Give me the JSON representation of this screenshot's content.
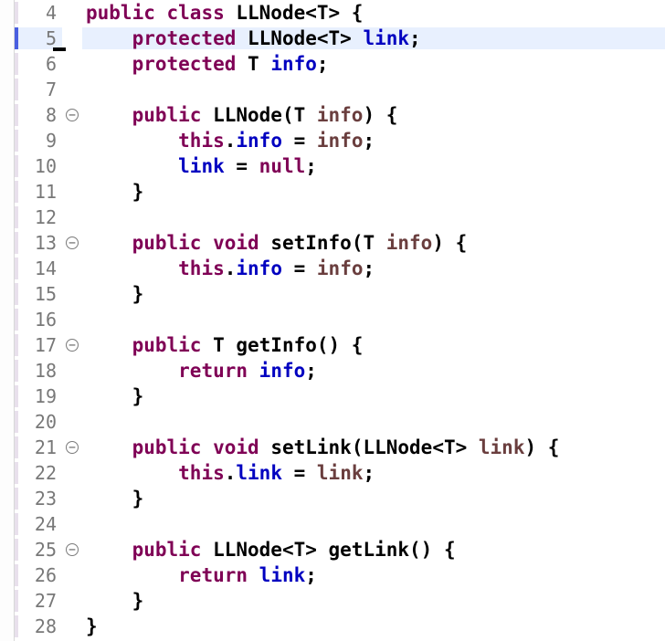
{
  "lines": [
    {
      "num": "4",
      "fold": "",
      "hl": false,
      "tokens": [
        [
          "kw",
          "public"
        ],
        [
          "plain",
          " "
        ],
        [
          "kw",
          "class"
        ],
        [
          "plain",
          " LLNode<T> {"
        ]
      ]
    },
    {
      "num": "5",
      "fold": "",
      "hl": true,
      "marked": true,
      "tokens": [
        [
          "plain",
          "    "
        ],
        [
          "kw",
          "protected"
        ],
        [
          "plain",
          " LLNode<T> "
        ],
        [
          "field",
          "link"
        ],
        [
          "plain",
          ";"
        ]
      ]
    },
    {
      "num": "6",
      "fold": "",
      "hl": false,
      "tokens": [
        [
          "plain",
          "    "
        ],
        [
          "kw",
          "protected"
        ],
        [
          "plain",
          " T "
        ],
        [
          "field",
          "info"
        ],
        [
          "plain",
          ";"
        ]
      ]
    },
    {
      "num": "7",
      "fold": "",
      "hl": false,
      "tokens": [
        [
          "plain",
          ""
        ]
      ]
    },
    {
      "num": "8",
      "fold": "⊖",
      "hl": false,
      "tokens": [
        [
          "plain",
          "    "
        ],
        [
          "kw",
          "public"
        ],
        [
          "plain",
          " LLNode(T "
        ],
        [
          "param",
          "info"
        ],
        [
          "plain",
          ") {"
        ]
      ]
    },
    {
      "num": "9",
      "fold": "",
      "hl": false,
      "tokens": [
        [
          "plain",
          "        "
        ],
        [
          "kw",
          "this"
        ],
        [
          "plain",
          "."
        ],
        [
          "field",
          "info"
        ],
        [
          "plain",
          " = "
        ],
        [
          "param",
          "info"
        ],
        [
          "plain",
          ";"
        ]
      ]
    },
    {
      "num": "10",
      "fold": "",
      "hl": false,
      "tokens": [
        [
          "plain",
          "        "
        ],
        [
          "field",
          "link"
        ],
        [
          "plain",
          " = "
        ],
        [
          "kw",
          "null"
        ],
        [
          "plain",
          ";"
        ]
      ]
    },
    {
      "num": "11",
      "fold": "",
      "hl": false,
      "tokens": [
        [
          "plain",
          "    }"
        ]
      ]
    },
    {
      "num": "12",
      "fold": "",
      "hl": false,
      "tokens": [
        [
          "plain",
          ""
        ]
      ]
    },
    {
      "num": "13",
      "fold": "⊖",
      "hl": false,
      "tokens": [
        [
          "plain",
          "    "
        ],
        [
          "kw",
          "public"
        ],
        [
          "plain",
          " "
        ],
        [
          "kw",
          "void"
        ],
        [
          "plain",
          " setInfo(T "
        ],
        [
          "param",
          "info"
        ],
        [
          "plain",
          ") {"
        ]
      ]
    },
    {
      "num": "14",
      "fold": "",
      "hl": false,
      "tokens": [
        [
          "plain",
          "        "
        ],
        [
          "kw",
          "this"
        ],
        [
          "plain",
          "."
        ],
        [
          "field",
          "info"
        ],
        [
          "plain",
          " = "
        ],
        [
          "param",
          "info"
        ],
        [
          "plain",
          ";"
        ]
      ]
    },
    {
      "num": "15",
      "fold": "",
      "hl": false,
      "tokens": [
        [
          "plain",
          "    }"
        ]
      ]
    },
    {
      "num": "16",
      "fold": "",
      "hl": false,
      "tokens": [
        [
          "plain",
          ""
        ]
      ]
    },
    {
      "num": "17",
      "fold": "⊖",
      "hl": false,
      "tokens": [
        [
          "plain",
          "    "
        ],
        [
          "kw",
          "public"
        ],
        [
          "plain",
          " T getInfo() {"
        ]
      ]
    },
    {
      "num": "18",
      "fold": "",
      "hl": false,
      "tokens": [
        [
          "plain",
          "        "
        ],
        [
          "kw",
          "return"
        ],
        [
          "plain",
          " "
        ],
        [
          "field",
          "info"
        ],
        [
          "plain",
          ";"
        ]
      ]
    },
    {
      "num": "19",
      "fold": "",
      "hl": false,
      "tokens": [
        [
          "plain",
          "    }"
        ]
      ]
    },
    {
      "num": "20",
      "fold": "",
      "hl": false,
      "tokens": [
        [
          "plain",
          ""
        ]
      ]
    },
    {
      "num": "21",
      "fold": "⊖",
      "hl": false,
      "tokens": [
        [
          "plain",
          "    "
        ],
        [
          "kw",
          "public"
        ],
        [
          "plain",
          " "
        ],
        [
          "kw",
          "void"
        ],
        [
          "plain",
          " setLink(LLNode<T> "
        ],
        [
          "param",
          "link"
        ],
        [
          "plain",
          ") {"
        ]
      ]
    },
    {
      "num": "22",
      "fold": "",
      "hl": false,
      "tokens": [
        [
          "plain",
          "        "
        ],
        [
          "kw",
          "this"
        ],
        [
          "plain",
          "."
        ],
        [
          "field",
          "link"
        ],
        [
          "plain",
          " = "
        ],
        [
          "param",
          "link"
        ],
        [
          "plain",
          ";"
        ]
      ]
    },
    {
      "num": "23",
      "fold": "",
      "hl": false,
      "tokens": [
        [
          "plain",
          "    }"
        ]
      ]
    },
    {
      "num": "24",
      "fold": "",
      "hl": false,
      "tokens": [
        [
          "plain",
          ""
        ]
      ]
    },
    {
      "num": "25",
      "fold": "⊖",
      "hl": false,
      "tokens": [
        [
          "plain",
          "    "
        ],
        [
          "kw",
          "public"
        ],
        [
          "plain",
          " LLNode<T> getLink() {"
        ]
      ]
    },
    {
      "num": "26",
      "fold": "",
      "hl": false,
      "tokens": [
        [
          "plain",
          "        "
        ],
        [
          "kw",
          "return"
        ],
        [
          "plain",
          " "
        ],
        [
          "field",
          "link"
        ],
        [
          "plain",
          ";"
        ]
      ]
    },
    {
      "num": "27",
      "fold": "",
      "hl": false,
      "tokens": [
        [
          "plain",
          "    }"
        ]
      ]
    },
    {
      "num": "28",
      "fold": "",
      "hl": false,
      "tokens": [
        [
          "plain",
          "}"
        ]
      ]
    }
  ],
  "fold_glyph": "⊖"
}
